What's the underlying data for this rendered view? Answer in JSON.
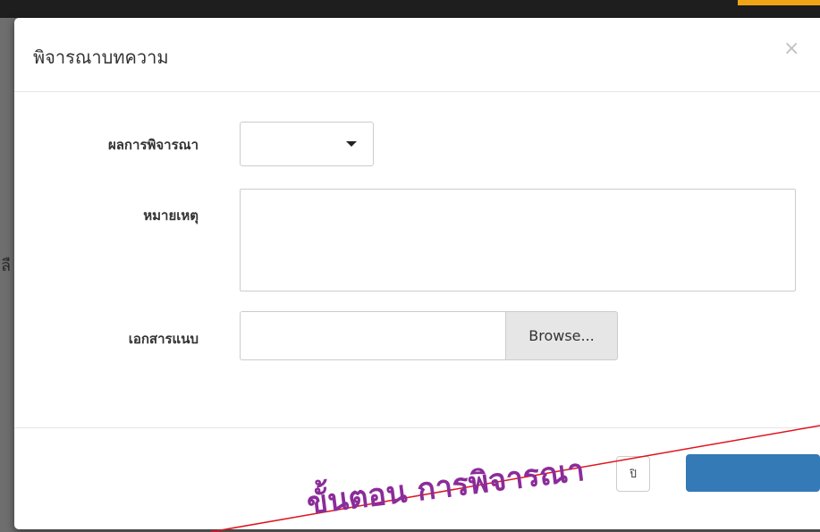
{
  "modal": {
    "title": "พิจารณาบทความ",
    "close_label": "×"
  },
  "form": {
    "result_label": "ผลการพิจารณา",
    "result_value": "",
    "note_label": "หมายเหตุ",
    "note_value": "",
    "attach_label": "เอกสารแนบ",
    "attach_value": "",
    "browse_label": "Browse..."
  },
  "footer": {
    "cancel_label": "ปิ",
    "save_label": ""
  },
  "annotation": {
    "text": "ขั้นตอน การพิจารณา",
    "color": "#8b2c9a",
    "line_color": "#e0141e"
  },
  "colors": {
    "topbar": "#1e1e1e",
    "topbar_accent": "#f0a417",
    "primary_button": "#337ab7"
  }
}
